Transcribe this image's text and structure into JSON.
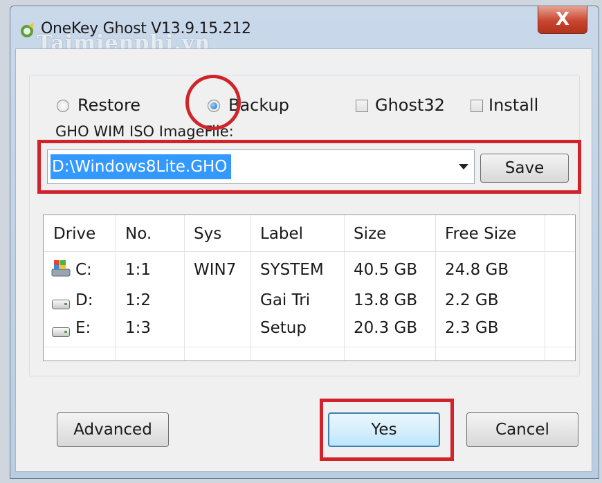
{
  "window": {
    "title": "OneKey Ghost V13.9.15.212",
    "watermark": "Taimienphi.vn",
    "close_glyph": "X"
  },
  "options": {
    "restore_label": "Restore",
    "backup_label": "Backup",
    "ghost32_label": "Ghost32",
    "install_label": "Install",
    "selected_mode": "Backup",
    "ghost32_checked": false,
    "install_checked": false
  },
  "image_file": {
    "label": "GHO WIM ISO ImageFile:",
    "value": "D:\\Windows8Lite.GHO",
    "save_label": "Save"
  },
  "table": {
    "headers": [
      "Drive",
      "No.",
      "Sys",
      "Label",
      "Size",
      "Free Size"
    ],
    "rows": [
      {
        "drive": "C:",
        "no": "1:1",
        "sys": "WIN7",
        "label": "SYSTEM",
        "size": "40.5 GB",
        "free": "24.8 GB",
        "icon": "system-drive-icon"
      },
      {
        "drive": "D:",
        "no": "1:2",
        "sys": "",
        "label": "Gai Tri",
        "size": "13.8 GB",
        "free": "2.2 GB",
        "icon": "drive-icon"
      },
      {
        "drive": "E:",
        "no": "1:3",
        "sys": "",
        "label": "Setup",
        "size": "20.3 GB",
        "free": "2.3 GB",
        "icon": "drive-icon"
      }
    ]
  },
  "buttons": {
    "advanced_label": "Advanced",
    "yes_label": "Yes",
    "cancel_label": "Cancel"
  },
  "colors": {
    "annotation": "#d0232a",
    "selection": "#3399ff",
    "close": "#c8452f"
  }
}
